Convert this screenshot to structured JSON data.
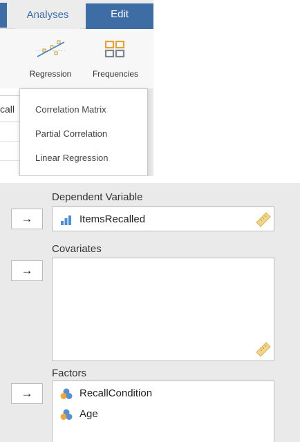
{
  "ribbon": {
    "tabs": [
      {
        "label": "Analyses",
        "active": false
      },
      {
        "label": "Edit",
        "active": true
      }
    ],
    "tools": [
      {
        "label": "Regression",
        "icon": "regression-icon"
      },
      {
        "label": "Frequencies",
        "icon": "frequencies-icon"
      }
    ],
    "behind_menu_text": "call",
    "menu": {
      "items": [
        "Correlation Matrix",
        "Partial Correlation",
        "Linear Regression"
      ]
    }
  },
  "panel": {
    "dependent": {
      "heading": "Dependent Variable",
      "arrow": "→",
      "variable": {
        "name": "ItemsRecalled",
        "icon": "continuous-variable-icon"
      }
    },
    "covariates": {
      "heading": "Covariates",
      "arrow": "→",
      "variables": []
    },
    "factors": {
      "heading": "Factors",
      "arrow": "→",
      "variables": [
        {
          "name": "RecallCondition",
          "icon": "nominal-variable-icon"
        },
        {
          "name": "Age",
          "icon": "nominal-variable-icon"
        }
      ]
    }
  },
  "colors": {
    "accent": "#3e6da6",
    "panel_bg": "#eaeaea",
    "ruler": "#f1d58c",
    "bar_icon": "#4a8fd6",
    "nominal_blue": "#5b8fc9",
    "nominal_orange": "#f2a73b"
  }
}
